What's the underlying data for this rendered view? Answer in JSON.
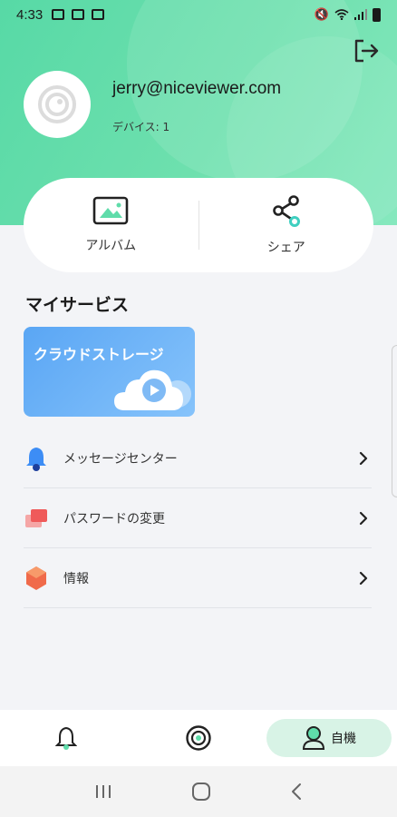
{
  "status_bar": {
    "time": "4:33"
  },
  "account": {
    "email": "jerry@niceviewer.com",
    "devices_label": "デバイス: 1"
  },
  "quick_actions": [
    {
      "label": "アルバム",
      "icon": "album-icon"
    },
    {
      "label": "シェア",
      "icon": "share-icon"
    }
  ],
  "section_title": "マイサービス",
  "cloud_storage": {
    "label": "クラウドストレージ"
  },
  "menu": [
    {
      "label": "メッセージセンター",
      "icon": "bell-icon"
    },
    {
      "label": "パスワードの変更",
      "icon": "password-icon"
    },
    {
      "label": "情報",
      "icon": "info-icon"
    }
  ],
  "bottom_nav": [
    {
      "label": "",
      "icon": "alerts-icon"
    },
    {
      "label": "",
      "icon": "camera-icon"
    },
    {
      "label": "自機",
      "icon": "profile-icon",
      "active": true
    }
  ],
  "colors": {
    "accent": "#5fdcaa",
    "active_tab_bg": "#d8f3e6",
    "cloud_card": "#5aa6f4"
  }
}
